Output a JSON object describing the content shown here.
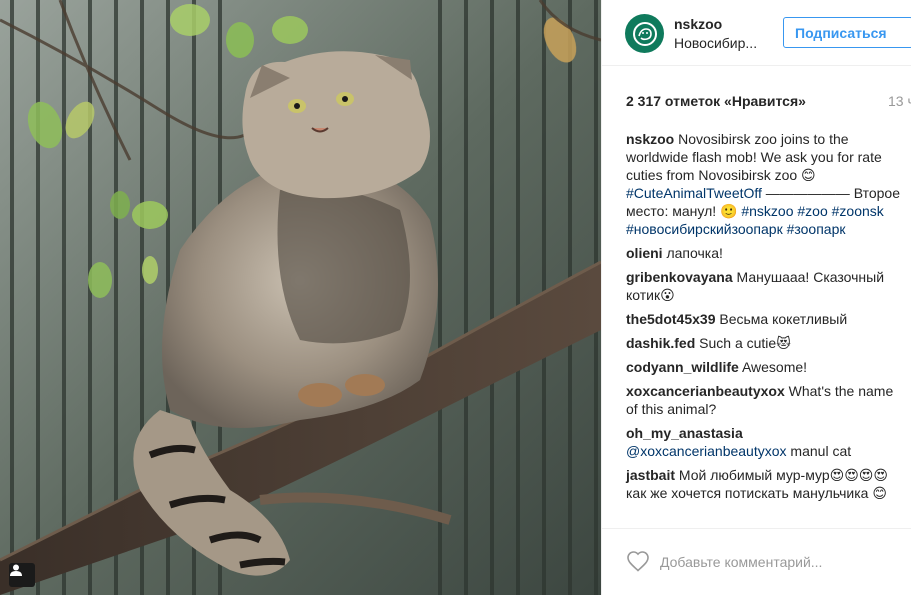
{
  "post": {
    "username": "nskzoo",
    "location": "Новосибир...",
    "follow_label": "Подписаться",
    "likes_label": "2 317 отметок «Нравится»",
    "time_label": "13 ч",
    "caption_user": "nskzoo",
    "caption_text": "Novosibirsk zoo joins to the worldwide flash mob! We ask you for rate cuties from Novosibirsk zoo 😊",
    "caption_tag1": "#CuteAnimalTweetOff",
    "caption_dash": " —————— Второе место: манул! 🙂 ",
    "caption_tag2": "#nskzoo",
    "caption_tag3": "#zoo",
    "caption_tag4": "#zoonsk",
    "caption_tag5": "#новосибирскийзоопарк",
    "caption_tag6": "#зоопарк"
  },
  "comments": [
    {
      "user": "olieni",
      "text": "лапочка!"
    },
    {
      "user": "gribenkovayana",
      "text": "Манушааа! Сказочный котик😮"
    },
    {
      "user": "the5dot45x39",
      "text": "Весьма кокетливый"
    },
    {
      "user": "dashik.fed",
      "text": "Such a cutie😻"
    },
    {
      "user": "codyann_wildlife",
      "text": "Awesome!"
    },
    {
      "user": "xoxcancerianbeautyxox",
      "text": "What's the name of this animal?"
    },
    {
      "user": "oh_my_anastasia",
      "mention": "@xoxcancerianbeautyxox",
      "text": " manul cat"
    },
    {
      "user": "jastbait",
      "text": "Мой любимый мур-мур😍😍😍😍 как же хочется потискать манульчика 😊"
    }
  ],
  "footer": {
    "comment_placeholder": "Добавьте комментарий..."
  },
  "icons": {
    "avatar": "snow-leopard-logo-icon",
    "heart": "heart-outline-icon",
    "photo_badge": "user-tag-icon"
  },
  "colors": {
    "link": "#003569",
    "follow": "#3897f0",
    "avatar_bg": "#0f7a5c"
  }
}
